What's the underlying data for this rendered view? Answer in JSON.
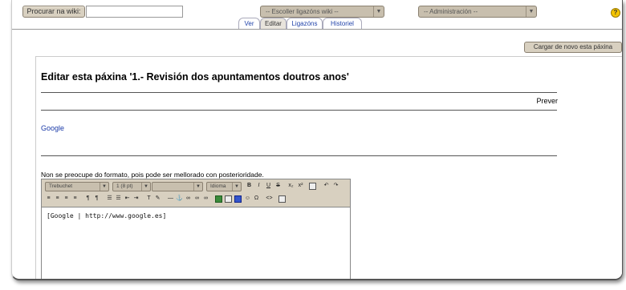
{
  "topbar": {
    "search_button": "Procurar na wiki:",
    "search_value": "",
    "links_select": "-- Escoller ligazóns wiki --",
    "admin_select": "-- Administración --",
    "help_icon": "help-icon"
  },
  "tabs": [
    {
      "label": "Ver"
    },
    {
      "label": "Editar"
    },
    {
      "label": "Ligazóns"
    },
    {
      "label": "Historiel"
    }
  ],
  "reload_button": "Cargar de novo esta páxina",
  "page": {
    "title": "Editar esta páxina '1.- Revisión dos apuntamentos doutros anos'",
    "preview": "Prever",
    "link": "Google",
    "note": "Non se preocupe do formato, pois pode ser mellorado con posterioridade."
  },
  "editor": {
    "font": "Trebuchet",
    "size": "1 (8 pt)",
    "style": "",
    "language": "Idioma",
    "content": "[Google | http://www.google.es]"
  }
}
